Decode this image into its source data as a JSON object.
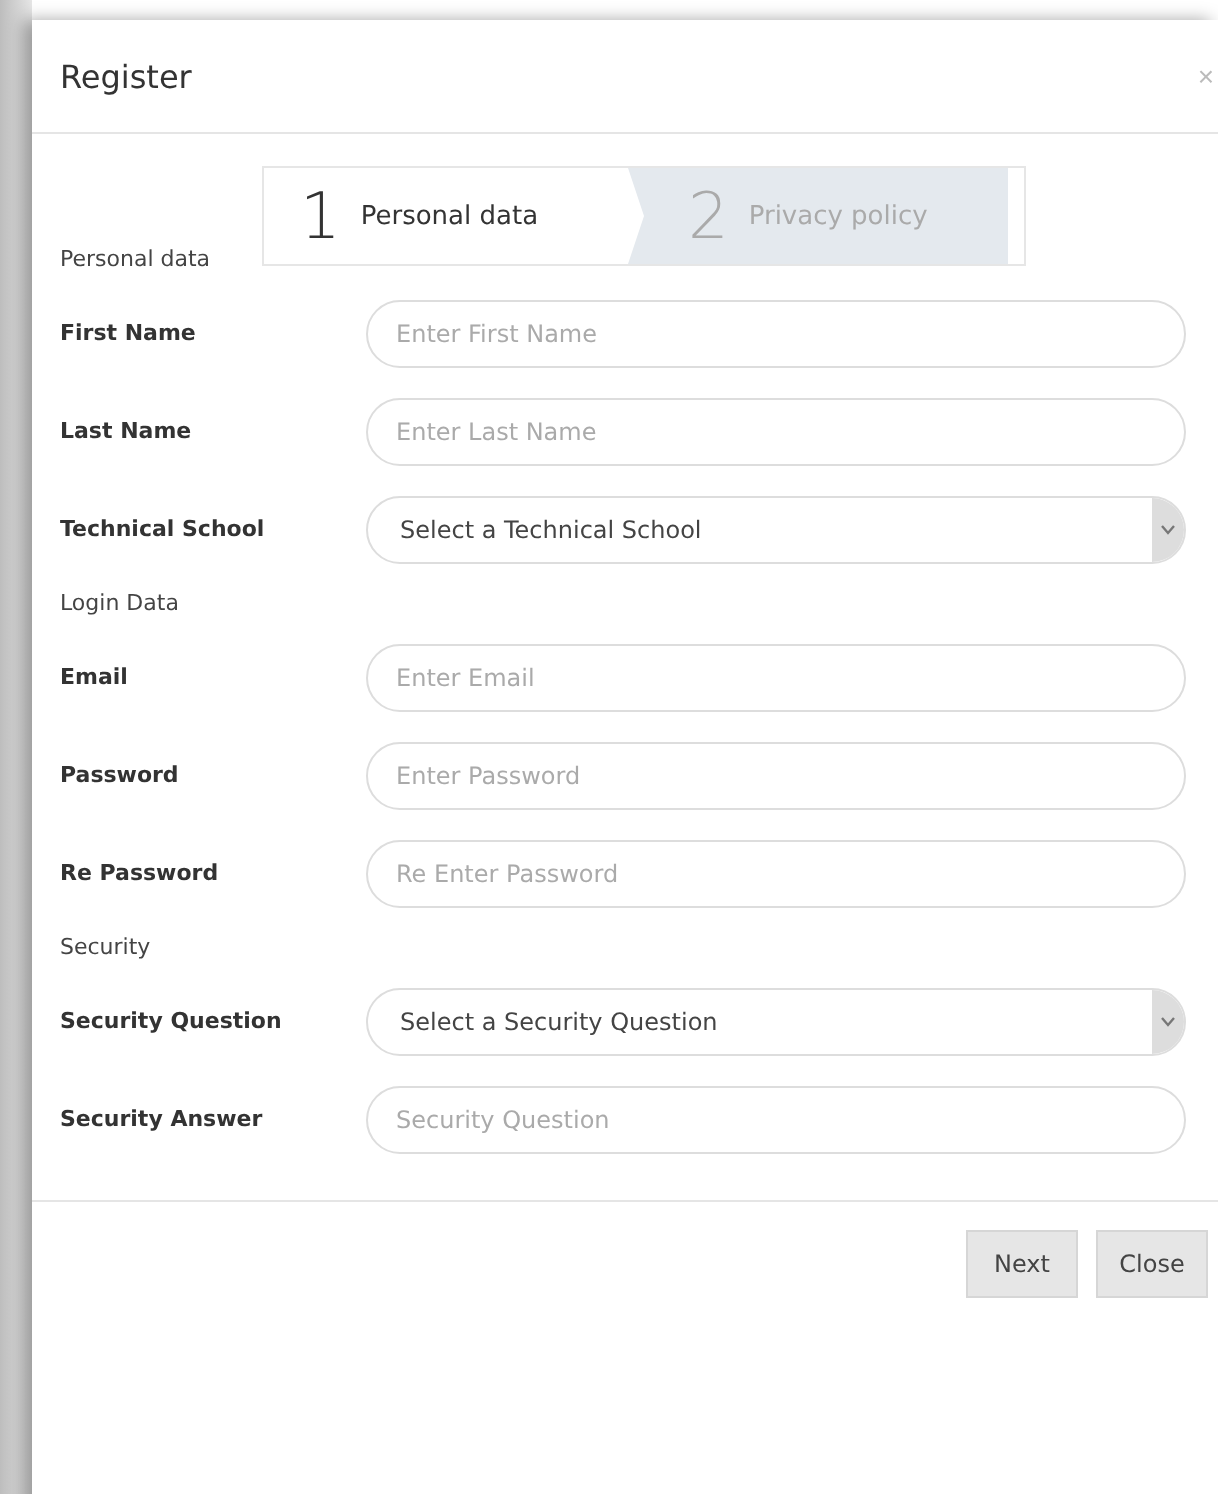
{
  "dialog": {
    "title": "Register",
    "close": "×"
  },
  "steps": [
    {
      "number": "1",
      "label": "Personal data",
      "selected": true
    },
    {
      "number": "2",
      "label": "Privacy policy",
      "selected": false
    }
  ],
  "sections": [
    {
      "title": "Personal data",
      "fields": [
        {
          "label": "First Name",
          "kind": "text",
          "placeholder": "Enter First Name"
        },
        {
          "label": "Last Name",
          "kind": "text",
          "placeholder": "Enter Last Name"
        },
        {
          "label": "Technical School",
          "kind": "select",
          "value": "Select a Technical School"
        }
      ]
    },
    {
      "title": "Login Data",
      "fields": [
        {
          "label": "Email",
          "kind": "text",
          "placeholder": "Enter Email"
        },
        {
          "label": "Password",
          "kind": "text",
          "placeholder": "Enter Password"
        },
        {
          "label": "Re Password",
          "kind": "text",
          "placeholder": "Re Enter Password"
        }
      ]
    },
    {
      "title": "Security",
      "fields": [
        {
          "label": "Security Question",
          "kind": "select",
          "value": "Select a Security Question"
        },
        {
          "label": "Security Answer",
          "kind": "text",
          "placeholder": "Security Question"
        }
      ]
    }
  ],
  "buttons": [
    "Next",
    "Close"
  ]
}
